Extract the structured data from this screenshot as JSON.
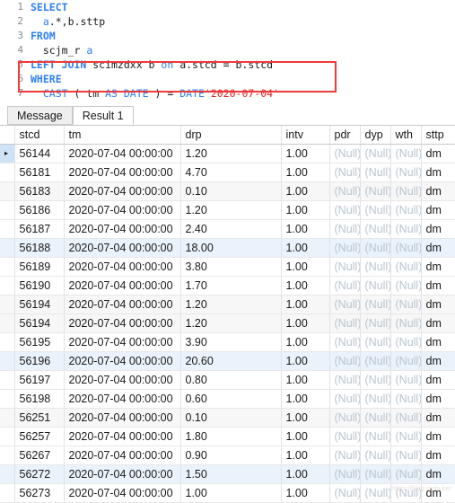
{
  "editor": {
    "lines": [
      {
        "no": "1",
        "tokens": [
          {
            "t": "SELECT",
            "c": "kw"
          }
        ]
      },
      {
        "no": "2",
        "tokens": [
          {
            "t": "  ",
            "c": "punct"
          },
          {
            "t": "a",
            "c": "kw2"
          },
          {
            "t": ".*,",
            "c": "punct"
          },
          {
            "t": "b",
            "c": "id"
          },
          {
            "t": ".sttp",
            "c": "id"
          }
        ]
      },
      {
        "no": "3",
        "tokens": [
          {
            "t": "FROM",
            "c": "kw"
          }
        ]
      },
      {
        "no": "4",
        "tokens": [
          {
            "t": "  scjm_r ",
            "c": "id"
          },
          {
            "t": "a",
            "c": "kw2"
          }
        ]
      },
      {
        "no": "5",
        "tokens": [
          {
            "t": "LEFT JOIN",
            "c": "kw"
          },
          {
            "t": " scimzdxx b ",
            "c": "id"
          },
          {
            "t": "on",
            "c": "kw2"
          },
          {
            "t": " a.stcd = b.stcd",
            "c": "id"
          }
        ]
      },
      {
        "no": "6",
        "tokens": [
          {
            "t": "WHERE",
            "c": "kw"
          }
        ]
      },
      {
        "no": "7",
        "tokens": [
          {
            "t": "  ",
            "c": "punct"
          },
          {
            "t": "CAST",
            "c": "kw2"
          },
          {
            "t": " ( tm ",
            "c": "id"
          },
          {
            "t": "AS DATE",
            "c": "kw2"
          },
          {
            "t": " ) = ",
            "c": "id"
          },
          {
            "t": "DATE",
            "c": "kw2"
          },
          {
            "t": "'2020-07-04'",
            "c": "str"
          }
        ]
      }
    ],
    "highlight_color": "#f03a3a"
  },
  "tabs": [
    {
      "label": "Message",
      "active": false
    },
    {
      "label": "Result 1",
      "active": true
    }
  ],
  "grid": {
    "columns": [
      "stcd",
      "tm",
      "drp",
      "intv",
      "pdr",
      "dyp",
      "wth",
      "sttp"
    ],
    "null_text": "(Null)",
    "row_marker": "▸",
    "rows": [
      {
        "stcd": "56144",
        "tm": "2020-07-04 00:00:00",
        "drp": "1.20",
        "intv": "1.00",
        "pdr": "(Null)",
        "dyp": "(Null)",
        "wth": "(Null)",
        "sttp": "dm",
        "shade": "white",
        "current": true
      },
      {
        "stcd": "56181",
        "tm": "2020-07-04 00:00:00",
        "drp": "4.70",
        "intv": "1.00",
        "pdr": "(Null)",
        "dyp": "(Null)",
        "wth": "(Null)",
        "sttp": "dm",
        "shade": "white",
        "current": false
      },
      {
        "stcd": "56183",
        "tm": "2020-07-04 00:00:00",
        "drp": "0.10",
        "intv": "1.00",
        "pdr": "(Null)",
        "dyp": "(Null)",
        "wth": "(Null)",
        "sttp": "dm",
        "shade": "gray",
        "current": false
      },
      {
        "stcd": "56186",
        "tm": "2020-07-04 00:00:00",
        "drp": "1.20",
        "intv": "1.00",
        "pdr": "(Null)",
        "dyp": "(Null)",
        "wth": "(Null)",
        "sttp": "dm",
        "shade": "white",
        "current": false
      },
      {
        "stcd": "56187",
        "tm": "2020-07-04 00:00:00",
        "drp": "2.40",
        "intv": "1.00",
        "pdr": "(Null)",
        "dyp": "(Null)",
        "wth": "(Null)",
        "sttp": "dm",
        "shade": "white",
        "current": false
      },
      {
        "stcd": "56188",
        "tm": "2020-07-04 00:00:00",
        "drp": "18.00",
        "intv": "1.00",
        "pdr": "(Null)",
        "dyp": "(Null)",
        "wth": "(Null)",
        "sttp": "dm",
        "shade": "blue",
        "current": false
      },
      {
        "stcd": "56189",
        "tm": "2020-07-04 00:00:00",
        "drp": "3.80",
        "intv": "1.00",
        "pdr": "(Null)",
        "dyp": "(Null)",
        "wth": "(Null)",
        "sttp": "dm",
        "shade": "white",
        "current": false
      },
      {
        "stcd": "56190",
        "tm": "2020-07-04 00:00:00",
        "drp": "1.70",
        "intv": "1.00",
        "pdr": "(Null)",
        "dyp": "(Null)",
        "wth": "(Null)",
        "sttp": "dm",
        "shade": "white",
        "current": false
      },
      {
        "stcd": "56194",
        "tm": "2020-07-04 00:00:00",
        "drp": "1.20",
        "intv": "1.00",
        "pdr": "(Null)",
        "dyp": "(Null)",
        "wth": "(Null)",
        "sttp": "dm",
        "shade": "gray",
        "current": false
      },
      {
        "stcd": "56194",
        "tm": "2020-07-04 00:00:00",
        "drp": "1.20",
        "intv": "1.00",
        "pdr": "(Null)",
        "dyp": "(Null)",
        "wth": "(Null)",
        "sttp": "dm",
        "shade": "gray",
        "current": false
      },
      {
        "stcd": "56195",
        "tm": "2020-07-04 00:00:00",
        "drp": "3.90",
        "intv": "1.00",
        "pdr": "(Null)",
        "dyp": "(Null)",
        "wth": "(Null)",
        "sttp": "dm",
        "shade": "white",
        "current": false
      },
      {
        "stcd": "56196",
        "tm": "2020-07-04 00:00:00",
        "drp": "20.60",
        "intv": "1.00",
        "pdr": "(Null)",
        "dyp": "(Null)",
        "wth": "(Null)",
        "sttp": "dm",
        "shade": "blue",
        "current": false
      },
      {
        "stcd": "56197",
        "tm": "2020-07-04 00:00:00",
        "drp": "0.80",
        "intv": "1.00",
        "pdr": "(Null)",
        "dyp": "(Null)",
        "wth": "(Null)",
        "sttp": "dm",
        "shade": "white",
        "current": false
      },
      {
        "stcd": "56198",
        "tm": "2020-07-04 00:00:00",
        "drp": "0.60",
        "intv": "1.00",
        "pdr": "(Null)",
        "dyp": "(Null)",
        "wth": "(Null)",
        "sttp": "dm",
        "shade": "white",
        "current": false
      },
      {
        "stcd": "56251",
        "tm": "2020-07-04 00:00:00",
        "drp": "0.10",
        "intv": "1.00",
        "pdr": "(Null)",
        "dyp": "(Null)",
        "wth": "(Null)",
        "sttp": "dm",
        "shade": "gray",
        "current": false
      },
      {
        "stcd": "56257",
        "tm": "2020-07-04 00:00:00",
        "drp": "1.80",
        "intv": "1.00",
        "pdr": "(Null)",
        "dyp": "(Null)",
        "wth": "(Null)",
        "sttp": "dm",
        "shade": "white",
        "current": false
      },
      {
        "stcd": "56267",
        "tm": "2020-07-04 00:00:00",
        "drp": "0.90",
        "intv": "1.00",
        "pdr": "(Null)",
        "dyp": "(Null)",
        "wth": "(Null)",
        "sttp": "dm",
        "shade": "white",
        "current": false
      },
      {
        "stcd": "56272",
        "tm": "2020-07-04 00:00:00",
        "drp": "1.50",
        "intv": "1.00",
        "pdr": "(Null)",
        "dyp": "(Null)",
        "wth": "(Null)",
        "sttp": "dm",
        "shade": "blue",
        "current": false
      },
      {
        "stcd": "56273",
        "tm": "2020-07-04 00:00:00",
        "drp": "1.00",
        "intv": "1.00",
        "pdr": "(Null)",
        "dyp": "(Null)",
        "wth": "(Null)",
        "sttp": "dm",
        "shade": "white",
        "current": false
      }
    ]
  },
  "watermark": "https://blog.csdn.net"
}
